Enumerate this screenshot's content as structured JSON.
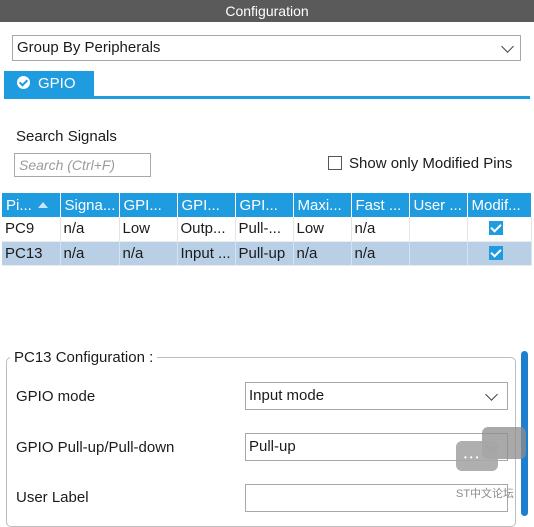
{
  "window": {
    "title": "Configuration"
  },
  "group_by": {
    "selected": "Group By Peripherals"
  },
  "tabs": [
    {
      "label": "GPIO",
      "checked": true
    }
  ],
  "search": {
    "label": "Search Signals",
    "placeholder": "Search (Ctrl+F)",
    "value": ""
  },
  "filter": {
    "label": "Show only Modified Pins",
    "checked": false
  },
  "table": {
    "columns": [
      "Pi...",
      "Signa...",
      "GPI...",
      "GPI...",
      "GPI...",
      "Maxi...",
      "Fast ...",
      "User ...",
      "Modif..."
    ],
    "sorted_column": 0,
    "rows": [
      {
        "pin": "PC9",
        "signal": "n/a",
        "gpio_output_level": "Low",
        "gpio_mode": "Outp...",
        "gpio_pull": "Pull-...",
        "max_speed": "Low",
        "fast_mode": "n/a",
        "user_label": "",
        "modified": true,
        "selected": false
      },
      {
        "pin": "PC13",
        "signal": "n/a",
        "gpio_output_level": "n/a",
        "gpio_mode": "Input ...",
        "gpio_pull": "Pull-up",
        "max_speed": "n/a",
        "fast_mode": "n/a",
        "user_label": "",
        "modified": true,
        "selected": true
      }
    ]
  },
  "config": {
    "title": "PC13 Configuration :",
    "fields": {
      "gpio_mode": {
        "label": "GPIO mode",
        "value": "Input mode"
      },
      "gpio_pull": {
        "label": "GPIO Pull-up/Pull-down",
        "value": "Pull-up"
      },
      "user_label": {
        "label": "User Label",
        "value": ""
      }
    }
  },
  "watermark": {
    "text": "ST中文论坛",
    "dots": "•••"
  },
  "colors": {
    "accent": "#1f9be0",
    "titlebar": "#5a5a5a",
    "selected_row": "#b8cfe6"
  }
}
